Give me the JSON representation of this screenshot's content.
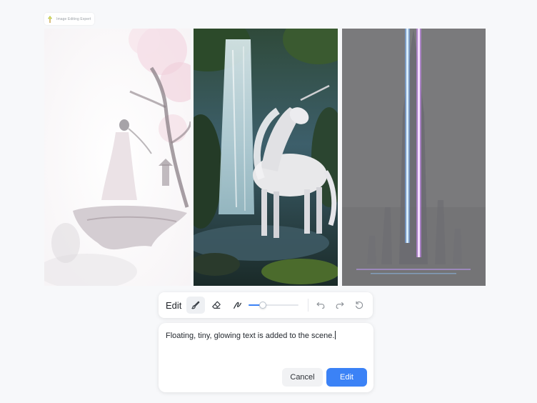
{
  "app": {
    "name": "Image Editing Expert"
  },
  "images": [
    {
      "label": "fantasy-floating-island-figure"
    },
    {
      "label": "unicorn-waterfall"
    },
    {
      "label": "neon-tower-city"
    }
  ],
  "toolbar": {
    "title": "Edit",
    "tools": [
      "brush-icon",
      "eraser-icon",
      "stroke-icon",
      "undo-icon",
      "redo-icon",
      "reset-icon"
    ],
    "brush_size": 0.28
  },
  "prompt": {
    "text": "Floating, tiny, glowing text is added to the scene.",
    "cancel_label": "Cancel",
    "edit_label": "Edit"
  },
  "colors": {
    "accent": "#3b82f6",
    "background": "#f7f8fa"
  }
}
